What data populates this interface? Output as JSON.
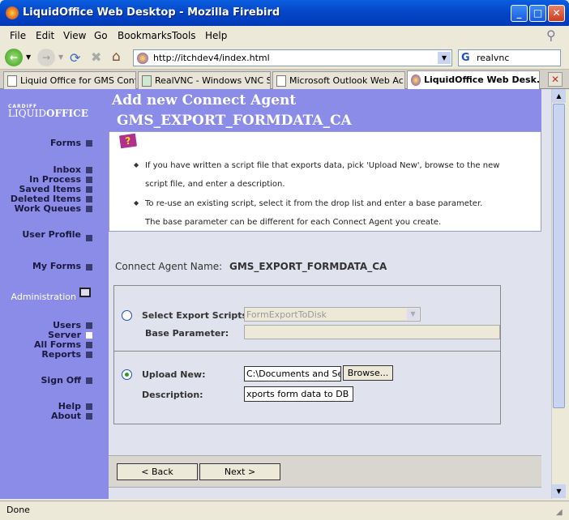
{
  "window": {
    "title": "LiquidOffice Web Desktop - Mozilla Firebird",
    "minimize": "_",
    "maximize": "□",
    "close": "✕"
  },
  "menu": [
    "File",
    "Edit",
    "View",
    "Go",
    "Bookmarks",
    "Tools",
    "Help"
  ],
  "nav": {
    "url": "http://itchdev4/index.html",
    "search": "realvnc",
    "search_icon_letter": "G"
  },
  "tabs": [
    {
      "label": "Liquid Office for GMS Conf..."
    },
    {
      "label": "RealVNC - Windows VNC S..."
    },
    {
      "label": "Microsoft Outlook Web Ac..."
    },
    {
      "label": "LiquidOffice Web Desk..."
    }
  ],
  "logo": {
    "top": "CARDIFF",
    "bottom_a": "LIQUID",
    "bottom_b": "OFFICE"
  },
  "sidebar": {
    "forms": "Forms",
    "inbox": "Inbox",
    "in_process": "In Process",
    "saved_items": "Saved Items",
    "deleted_items": "Deleted Items",
    "work_queues": "Work Queues",
    "user_profile": "User Profile",
    "my_forms": "My Forms",
    "administration": "Administration",
    "users": "Users",
    "server": "Server",
    "all_forms": "All Forms",
    "reports": "Reports",
    "sign_off": "Sign Off",
    "help": "Help",
    "about": "About"
  },
  "page": {
    "title": "Add new Connect Agent",
    "subtitle": "GMS_EXPORT_FORMDATA_CA"
  },
  "help": {
    "line1": "If you have written a script file that exports data, pick 'Upload New', browse to the new",
    "line2": "script file, and enter a description.",
    "line3": "To re-use an existing script, select it from the drop list and enter a base parameter.",
    "line4": "The base parameter can be different for each Connect Agent you create."
  },
  "form": {
    "agent_name_label": "Connect Agent Name:",
    "agent_name": "GMS_EXPORT_FORMDATA_CA",
    "select_label": "Select Export Scripts:",
    "select_value": "FormExportToDisk",
    "base_label": "Base Parameter:",
    "base_value": "",
    "upload_label": "Upload New:",
    "upload_value": "C:\\Documents and Setti",
    "browse": "Browse...",
    "desc_label": "Description:",
    "desc_value": "xports form data to DB"
  },
  "buttons": {
    "back": "< Back",
    "next": "Next >"
  },
  "status": "Done"
}
